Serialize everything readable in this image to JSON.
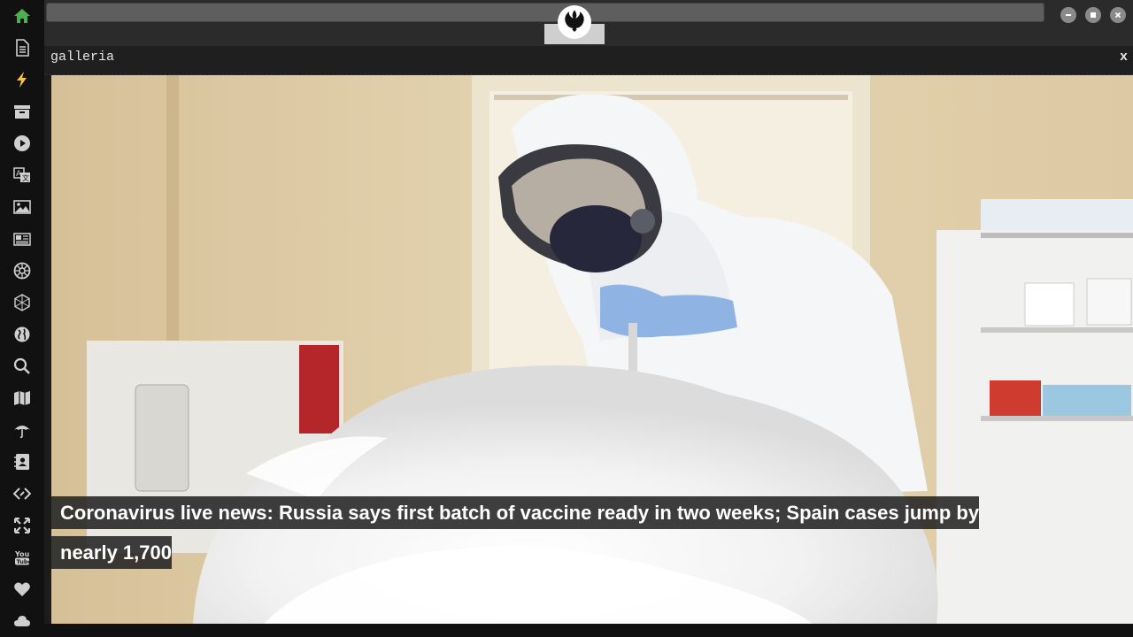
{
  "app": {
    "logo_icon": "rebel-alliance-icon"
  },
  "sidebar": {
    "items": [
      {
        "icon": "home-icon",
        "color": "#4caf50"
      },
      {
        "icon": "document-icon",
        "color": "#cfcfcf"
      },
      {
        "icon": "lightning-icon",
        "color": "#f5c542"
      },
      {
        "icon": "archive-icon",
        "color": "#cfcfcf"
      },
      {
        "icon": "play-icon",
        "color": "#cfcfcf"
      },
      {
        "icon": "translate-icon",
        "color": "#cfcfcf"
      },
      {
        "icon": "image-icon",
        "color": "#cfcfcf"
      },
      {
        "icon": "newspaper-icon",
        "color": "#cfcfcf"
      },
      {
        "icon": "empire-icon",
        "color": "#cfcfcf"
      },
      {
        "icon": "hexagon-icon",
        "color": "#cfcfcf"
      },
      {
        "icon": "globe-icon",
        "color": "#cfcfcf"
      },
      {
        "icon": "search-icon",
        "color": "#cfcfcf"
      },
      {
        "icon": "map-icon",
        "color": "#cfcfcf"
      },
      {
        "icon": "umbrella-icon",
        "color": "#cfcfcf"
      },
      {
        "icon": "contact-book-icon",
        "color": "#cfcfcf"
      },
      {
        "icon": "code-icon",
        "color": "#cfcfcf"
      },
      {
        "icon": "expand-icon",
        "color": "#cfcfcf"
      },
      {
        "icon": "youtube-icon",
        "color": "#cfcfcf"
      },
      {
        "icon": "heart-icon",
        "color": "#cfcfcf"
      },
      {
        "icon": "cloud-icon",
        "color": "#cfcfcf"
      }
    ]
  },
  "panel": {
    "title": "galleria",
    "close_label": "x"
  },
  "gallery": {
    "caption": "Coronavirus live news: Russia says first batch of vaccine ready in two weeks; Spain cases jump by nearly 1,700"
  }
}
